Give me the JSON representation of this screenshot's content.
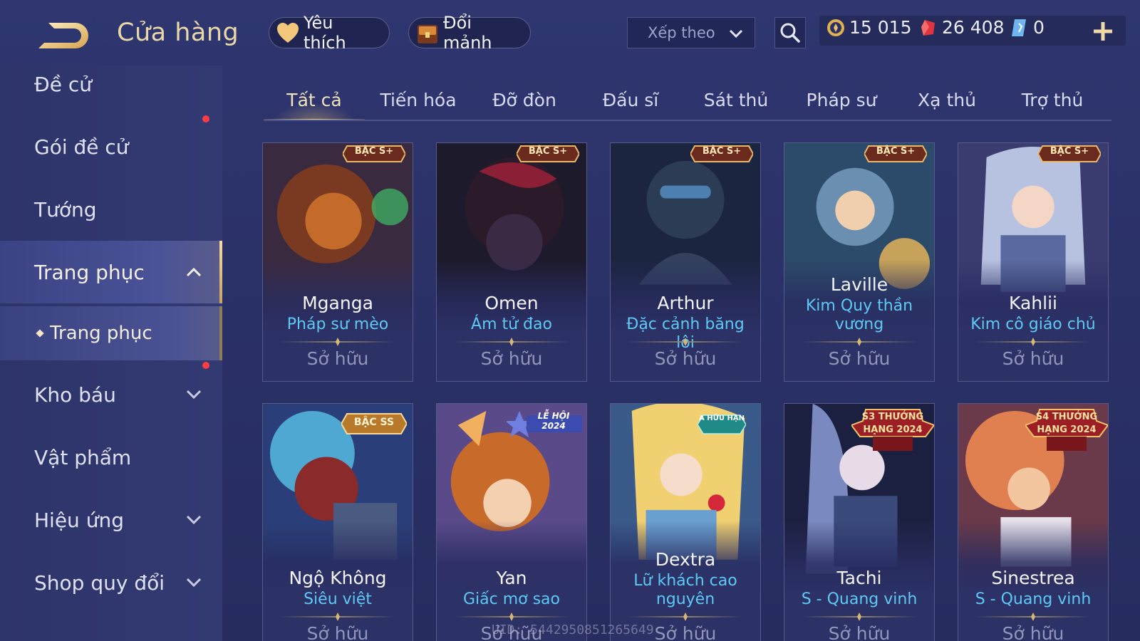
{
  "header": {
    "title": "Cửa hàng",
    "favorites_label": "Yêu thích",
    "exchange_label": "Đổi mảnh",
    "sort_label": "Xếp theo"
  },
  "currency": {
    "gold": "15 015",
    "ruby": "26 408",
    "voucher": "0"
  },
  "sidebar": {
    "items": [
      {
        "label": "Đề cử"
      },
      {
        "label": "Gói đề cử",
        "notify": true
      },
      {
        "label": "Tướng"
      },
      {
        "label": "Trang phục",
        "expanded": true
      },
      {
        "label": "Trang phục",
        "sub": true
      },
      {
        "label": "Kho báu",
        "notify": true
      },
      {
        "label": "Vật phẩm"
      },
      {
        "label": "Hiệu ứng"
      },
      {
        "label": "Shop quy đổi"
      }
    ]
  },
  "tabs": [
    "Tất cả",
    "Tiến hóa",
    "Đỡ đòn",
    "Đấu sĩ",
    "Sát thủ",
    "Pháp sư",
    "Xạ thủ",
    "Trợ thủ"
  ],
  "owned_label": "Sở hữu",
  "cards": [
    {
      "hero": "Mganga",
      "skin": "Pháp sư mèo",
      "badge": "BẬC S+",
      "colors": [
        "#7a3a22",
        "#c46a2a",
        "#3a2a3f"
      ]
    },
    {
      "hero": "Omen",
      "skin": "Ám tử đao",
      "badge": "BẬC S+",
      "colors": [
        "#2b1a2a",
        "#8a1f35",
        "#1d1a2c"
      ]
    },
    {
      "hero": "Arthur",
      "skin": "Đặc cảnh băng lôi",
      "badge": "BẬC S+",
      "colors": [
        "#2d3c55",
        "#4d7fb0",
        "#1c2540"
      ]
    },
    {
      "hero": "Laville",
      "skin": "Kim Quy thần vương",
      "badge": "BẬC S+",
      "colors": [
        "#6a8fb0",
        "#c6a25a",
        "#2c4a6a"
      ]
    },
    {
      "hero": "Kahlii",
      "skin": "Kim cô giáo chủ",
      "badge": "BẬC S+",
      "colors": [
        "#5a6aa0",
        "#b7c2e0",
        "#3a3c70"
      ]
    },
    {
      "hero": "Ngộ Không",
      "skin": "Siêu việt",
      "badge": "BẬC SS",
      "colors": [
        "#2a3f7a",
        "#59c3e8",
        "#8a2a2a"
      ]
    },
    {
      "hero": "Yan",
      "skin": "Giấc mơ sao",
      "badge": "LỄ HỘI 2024",
      "colors": [
        "#c86a2a",
        "#f0b060",
        "#5a4a8a"
      ]
    },
    {
      "hero": "Dextra",
      "skin": "Lữ khách cao nguyên",
      "badge": "A HỮU HẠN",
      "colors": [
        "#f0d070",
        "#6aa0d0",
        "#3a5a8a"
      ]
    },
    {
      "hero": "Tachi",
      "skin": "S - Quang vinh",
      "badge": "S3 THƯỞNG HẠNG 2024",
      "colors": [
        "#3a4a7a",
        "#7a8ac0",
        "#1c2040"
      ]
    },
    {
      "hero": "Sinestrea",
      "skin": "S - Quang vinh",
      "badge": "S4 THƯỞNG HẠNG 2024",
      "colors": [
        "#e08050",
        "#f3c6a0",
        "#6a3a4a"
      ]
    }
  ],
  "watermark": "UID: 5442950851265649"
}
